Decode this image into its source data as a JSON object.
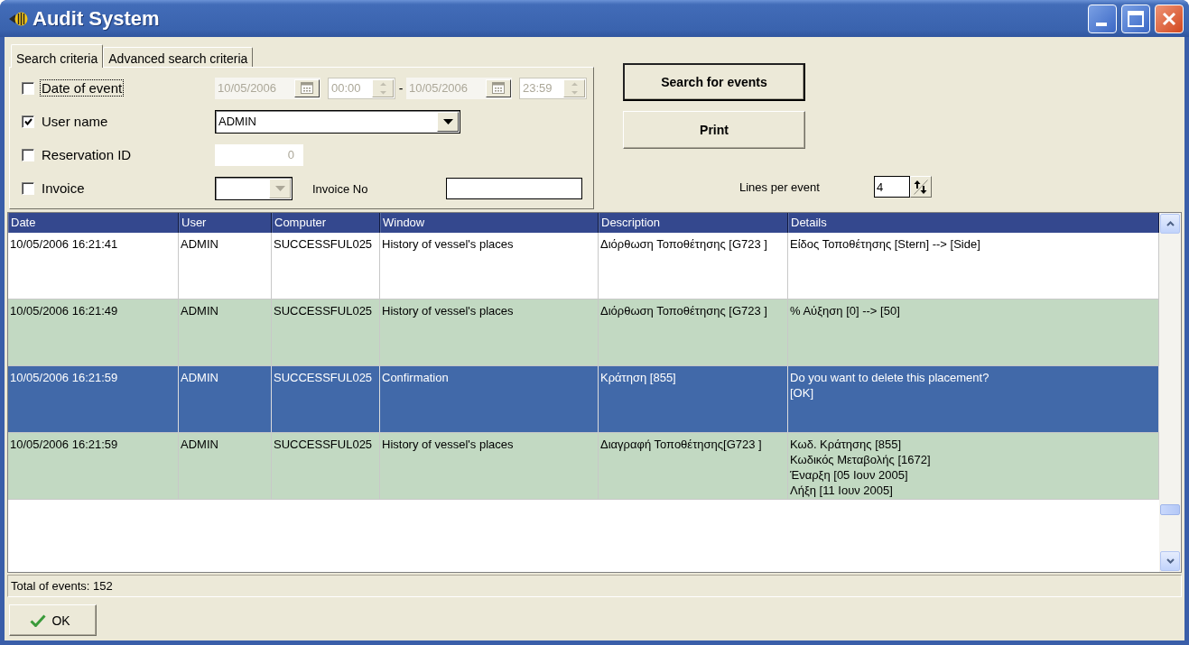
{
  "window": {
    "title": "Audit System"
  },
  "tabs": [
    {
      "label": "Search criteria",
      "selected": true
    },
    {
      "label": "Advanced search criteria",
      "selected": false
    }
  ],
  "criteria": [
    {
      "kind": "date_range",
      "label": "Date of event",
      "checked": false,
      "focused": true,
      "disabled": true,
      "from_date": "10/05/2006",
      "from_time": "00:00",
      "separator": "-",
      "to_date": "10/05/2006",
      "to_time": "23:59"
    },
    {
      "kind": "dropdown",
      "label": "User name",
      "checked": true,
      "focused": false,
      "disabled": false,
      "value": "ADMIN"
    },
    {
      "kind": "number",
      "label": "Reservation ID",
      "checked": false,
      "focused": false,
      "disabled": true,
      "value": "0"
    },
    {
      "kind": "invoice",
      "label": "Invoice",
      "checked": false,
      "focused": false,
      "disabled": true,
      "number_label": "Invoice No"
    }
  ],
  "actions": [
    {
      "label": "Search for events",
      "default": true
    },
    {
      "label": "Print",
      "default": false
    }
  ],
  "lines_per_event": {
    "label": "Lines per event",
    "value": "4"
  },
  "table": {
    "columns": [
      "Date",
      "User",
      "Computer",
      "Window",
      "Description",
      "Details"
    ],
    "rows": [
      {
        "selected": false,
        "cells": [
          "10/05/2006 16:21:41",
          "ADMIN",
          "SUCCESSFUL025",
          "History of vessel's places",
          "Διόρθωση Τοποθέτησης [G723 ]",
          "Είδος Τοποθέτησης [Stern] --> [Side]"
        ]
      },
      {
        "selected": false,
        "cells": [
          "10/05/2006 16:21:49",
          "ADMIN",
          "SUCCESSFUL025",
          "History of vessel's places",
          "Διόρθωση Τοποθέτησης [G723 ]",
          "% Αύξηση [0] --> [50]"
        ]
      },
      {
        "selected": true,
        "cells": [
          "10/05/2006 16:21:59",
          "ADMIN",
          "SUCCESSFUL025",
          "Confirmation",
          "Κράτηση [855]",
          "Do you want to delete this placement?\n[OK]"
        ]
      },
      {
        "selected": false,
        "cells": [
          "10/05/2006 16:21:59",
          "ADMIN",
          "SUCCESSFUL025",
          "History of vessel's places",
          "Διαγραφή Τοποθέτησης[G723 ]",
          "Κωδ. Κράτησης [855]\nΚωδικός Μεταβολής [1672]\nΈναρξη [05 Ιουν 2005]\nΛήξη [11 Ιουν 2005]"
        ]
      }
    ]
  },
  "status_bar": {
    "text": "Total of events: 152"
  },
  "ok_button": {
    "label": "OK"
  }
}
